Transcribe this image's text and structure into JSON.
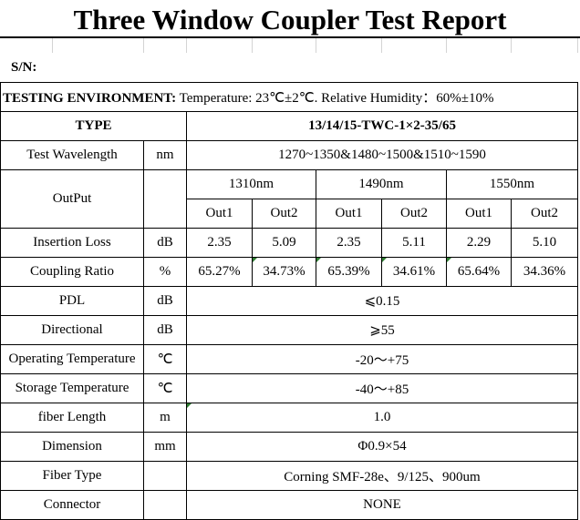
{
  "title": "Three Window Coupler Test Report",
  "serial": {
    "label": "S/N:",
    "value": ""
  },
  "environment": {
    "label": "TESTING ENVIRONMENT:",
    "text": "Temperature: 23℃±2℃. Relative Humidity：60%±10%"
  },
  "type": {
    "label": "TYPE",
    "value": "13/14/15-TWC-1×2-35/65"
  },
  "test_wavelength": {
    "label": "Test Wavelength",
    "unit": "nm",
    "value": "1270~1350&1480~1500&1510~1590"
  },
  "output": {
    "label": "OutPut",
    "wavelengths": [
      "1310nm",
      "1490nm",
      "1550nm"
    ],
    "ports": [
      "Out1",
      "Out2",
      "Out1",
      "Out2",
      "Out1",
      "Out2"
    ]
  },
  "insertion_loss": {
    "label": "Insertion Loss",
    "unit": "dB",
    "values": [
      "2.35",
      "5.09",
      "2.35",
      "5.11",
      "2.29",
      "5.10"
    ]
  },
  "coupling_ratio": {
    "label": "Coupling Ratio",
    "unit": "%",
    "values": [
      "65.27%",
      "34.73%",
      "65.39%",
      "34.61%",
      "65.64%",
      "34.36%"
    ]
  },
  "specs": [
    {
      "label": "PDL",
      "unit": "dB",
      "value": "⩽0.15"
    },
    {
      "label": "Directional",
      "unit": "dB",
      "value": "⩾55"
    },
    {
      "label": "Operating Temperature",
      "unit": "℃",
      "value": "-20～+75"
    },
    {
      "label": "Storage Temperature",
      "unit": "℃",
      "value": "-40～+85"
    },
    {
      "label": "fiber Length",
      "unit": "m",
      "value": "1.0"
    },
    {
      "label": "Dimension",
      "unit": "mm",
      "value": "Φ0.9×54"
    },
    {
      "label": "Fiber Type",
      "unit": "",
      "value": "Corning SMF-28e、9/125、900um"
    },
    {
      "label": "Connector",
      "unit": "",
      "value": "NONE"
    }
  ]
}
